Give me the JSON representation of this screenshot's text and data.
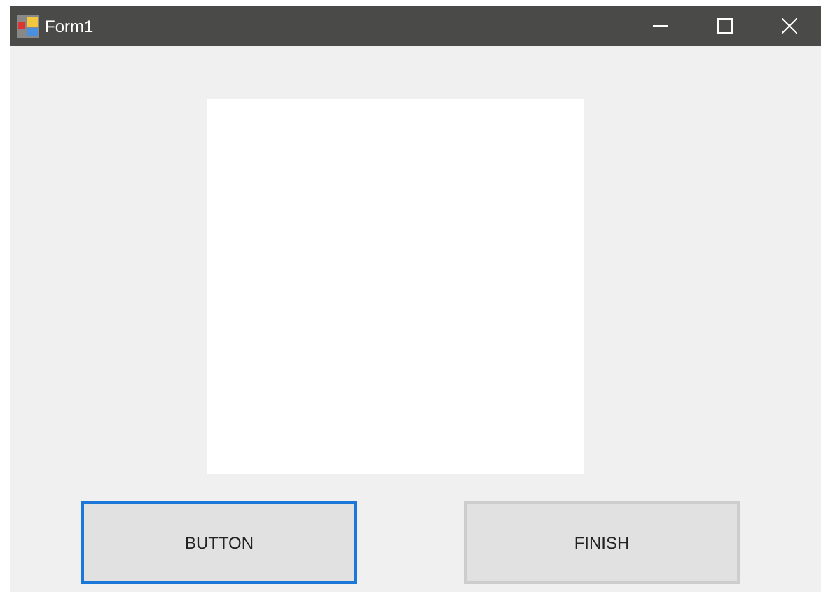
{
  "window": {
    "title": "Form1"
  },
  "buttons": [
    {
      "label": "BUTTON",
      "focused": true
    },
    {
      "label": "FINISH",
      "focused": false
    }
  ]
}
